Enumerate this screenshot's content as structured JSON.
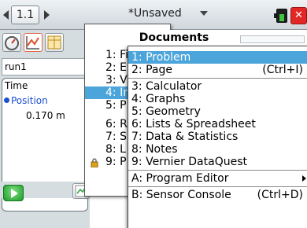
{
  "top_bar": {
    "page_tab": "1.1",
    "document_title": "*Unsaved"
  },
  "left_panel": {
    "dataset": "run1",
    "meter": {
      "time_label": "Time",
      "sensor_label": "Position",
      "sensor_value": "0.170 m"
    }
  },
  "documents_menu": {
    "title": "Documents",
    "items": [
      "1: Fi",
      "2: E",
      "3: V",
      "4: In",
      "5: P",
      "6: R",
      "7: S",
      "8: L",
      "9: P"
    ],
    "selected_index": 3
  },
  "insert_menu": {
    "items": [
      {
        "label": "1: Problem",
        "shortcut": ""
      },
      {
        "label": "2: Page",
        "shortcut": "(Ctrl+I)"
      },
      {
        "label": "3: Calculator",
        "shortcut": ""
      },
      {
        "label": "4: Graphs",
        "shortcut": ""
      },
      {
        "label": "5: Geometry",
        "shortcut": ""
      },
      {
        "label": "6: Lists & Spreadsheet",
        "shortcut": ""
      },
      {
        "label": "7: Data & Statistics",
        "shortcut": ""
      },
      {
        "label": "8: Notes",
        "shortcut": ""
      },
      {
        "label": "9: Vernier DataQuest",
        "shortcut": ""
      },
      {
        "label": "A: Program Editor",
        "shortcut": ""
      },
      {
        "label": "B: Sensor Console",
        "shortcut": "(Ctrl+D)"
      }
    ],
    "selected_index": 0
  },
  "colors": {
    "selection": "#4ba5db",
    "close_button": "#e22727",
    "sensor_text": "#1a4fcf",
    "play_button": "#1d9a2b"
  },
  "icons": {
    "nav_left": "left-arrow-icon",
    "nav_right": "right-arrow-icon",
    "battery": "battery-icon",
    "close": "close-icon",
    "meter_view": "dial-icon",
    "graph_view": "graph-icon",
    "table_view": "table-icon",
    "collect": "play-icon",
    "lock": "lock-icon"
  }
}
